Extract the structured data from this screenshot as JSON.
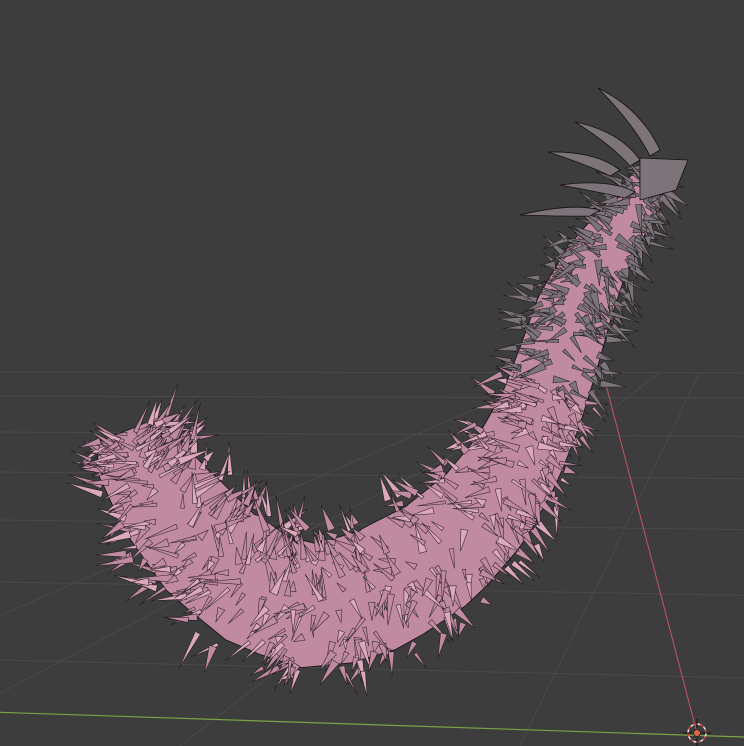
{
  "viewport": {
    "view": "3D Viewport",
    "shading": "wireframe",
    "object": "fur-tail-mesh",
    "colors": {
      "background": "#3d3d3d",
      "grid": "#4a4a4a",
      "x_axis": "#b8545f",
      "y_axis": "#7aa543",
      "fur_fill": "#c08aa0",
      "fur_light": "#dca8bc",
      "wire": "#141014",
      "head": "#7d7479",
      "origin": "#d8684a"
    },
    "icons": {
      "origin": "origin-marker-icon",
      "cursor": "3d-cursor-icon"
    }
  }
}
